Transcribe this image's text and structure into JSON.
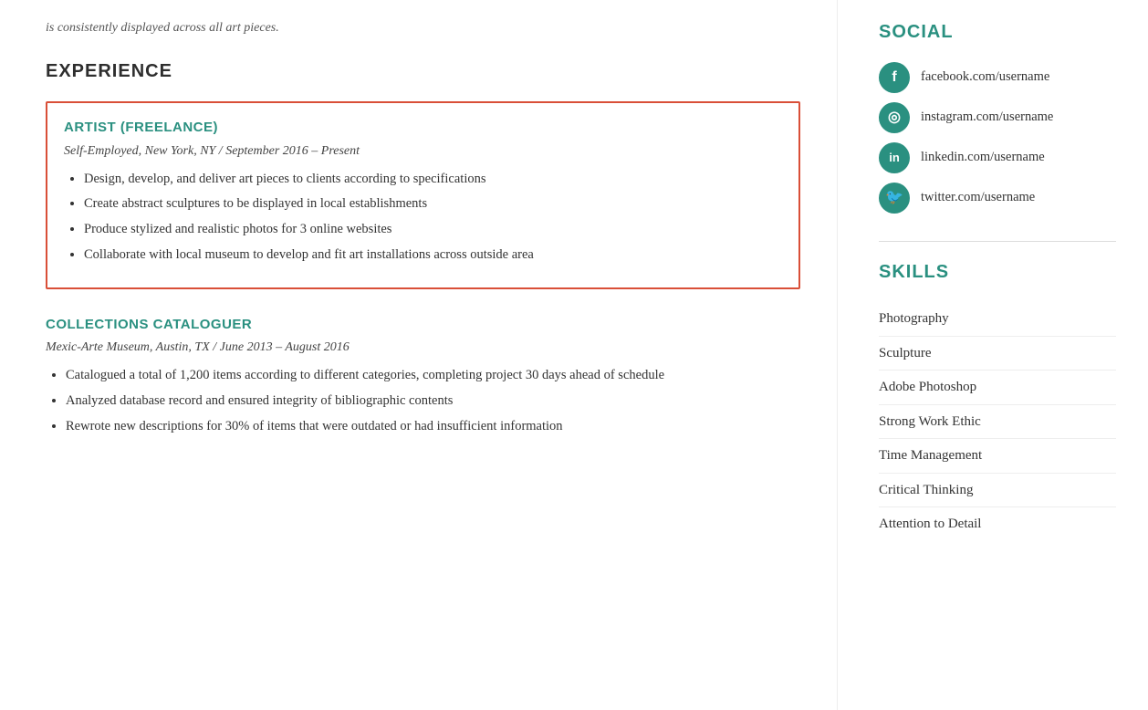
{
  "top_text": "is consistently displayed across all art pieces.",
  "left_col": {
    "experience_heading": "EXPERIENCE",
    "jobs": [
      {
        "id": "artist-freelance",
        "title": "ARTIST (FREELANCE)",
        "meta": "Self-Employed, New York, NY  /  September 2016 – Present",
        "highlighted": true,
        "bullets": [
          "Design, develop, and deliver art pieces to clients according to specifications",
          "Create abstract sculptures to be displayed in local establishments",
          "Produce stylized and realistic photos for 3 online websites",
          "Collaborate with local museum to develop and fit art installations across outside area"
        ]
      },
      {
        "id": "collections-cataloguer",
        "title": "COLLECTIONS CATALOGUER",
        "meta": "Mexic-Arte Museum, Austin, TX  /  June 2013 – August 2016",
        "highlighted": false,
        "bullets": [
          "Catalogued a total of 1,200 items according to different categories, completing project 30 days ahead of schedule",
          "Analyzed database record and ensured integrity of bibliographic contents",
          "Rewrote new descriptions for 30% of items that were outdated or had insufficient information"
        ]
      }
    ]
  },
  "right_col": {
    "social_heading": "SOCIAL",
    "social_items": [
      {
        "icon": "f",
        "label": "facebook.com/username",
        "name": "facebook"
      },
      {
        "icon": "⊙",
        "label": "instagram.com/username",
        "name": "instagram"
      },
      {
        "icon": "in",
        "label": "linkedin.com/username",
        "name": "linkedin"
      },
      {
        "icon": "🐦",
        "label": "twitter.com/username",
        "name": "twitter"
      }
    ],
    "skills_heading": "SKILLS",
    "skills": [
      "Photography",
      "Sculpture",
      "Adobe Photoshop",
      "Strong Work Ethic",
      "Time Management",
      "Critical Thinking",
      "Attention to Detail"
    ]
  }
}
